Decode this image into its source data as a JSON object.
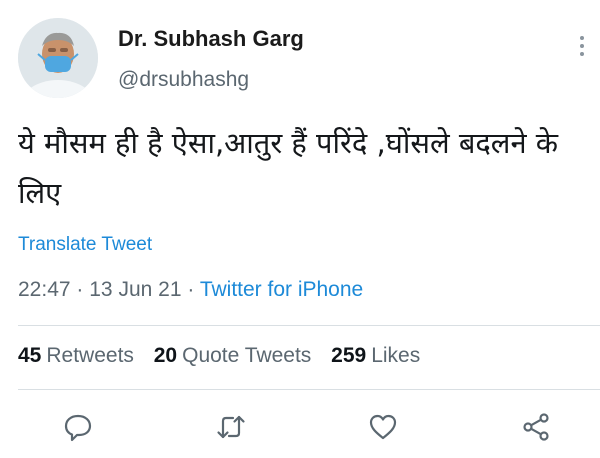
{
  "author": {
    "display_name": "Dr. Subhash Garg",
    "handle": "@drsubhashg",
    "avatar_icon": "profile-photo-masked-man"
  },
  "menu_icon": "more-vertical-icon",
  "tweet": {
    "text": "ये मौसम ही है ऐसा,आतुर हैं परिंदे ,घोंसले बदलने के लिए",
    "translate_label": "Translate Tweet",
    "time": "22:47",
    "separator": "·",
    "date": "13 Jun 21",
    "source": "Twitter for iPhone"
  },
  "stats": {
    "retweets": {
      "count": "45",
      "label": "Retweets"
    },
    "quote_tweets": {
      "count": "20",
      "label": "Quote Tweets"
    },
    "likes": {
      "count": "259",
      "label": "Likes"
    }
  },
  "actions": [
    "reply-icon",
    "retweet-icon",
    "like-icon",
    "share-icon"
  ],
  "colors": {
    "link": "#1d8ad8",
    "secondary_text": "#5b6770",
    "icon": "#5b6770",
    "divider": "#d9dfe3"
  }
}
